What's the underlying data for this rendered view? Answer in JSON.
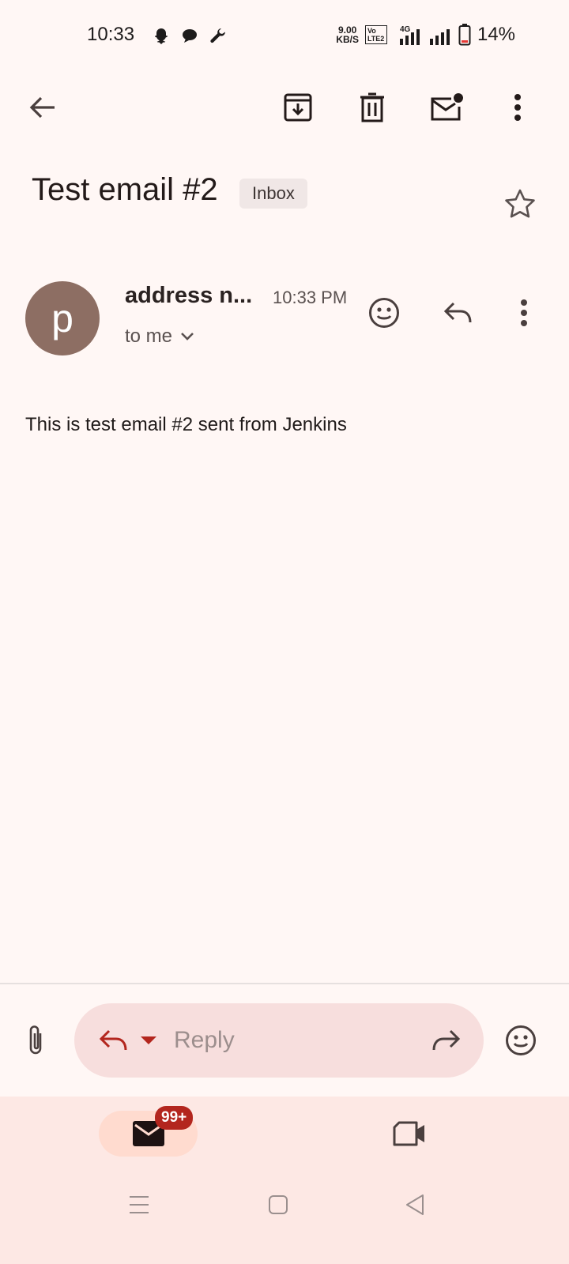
{
  "status": {
    "time": "10:33",
    "net_speed_top": "9.00",
    "net_speed_bottom": "KB/S",
    "volte": "Vo LTE2",
    "gen": "4G",
    "battery": "14%"
  },
  "toolbar": {
    "back": "back-arrow-icon",
    "archive": "archive-icon",
    "delete": "trash-icon",
    "mark_unread": "mark-unread-icon",
    "more": "more-vert-icon"
  },
  "email": {
    "subject": "Test email #2",
    "label_chip": "Inbox",
    "avatar_letter": "p",
    "sender": "address n...",
    "time": "10:33 PM",
    "to_line": "to me",
    "body": "This is test email #2 sent from Jenkins"
  },
  "reply_bar": {
    "placeholder": "Reply"
  },
  "bottom_nav": {
    "mail_badge": "99+"
  },
  "colors": {
    "background": "#fff7f5",
    "avatar": "#8d6e63",
    "reply_pill": "#f7dedd",
    "accent_red": "#b3261e",
    "nav_bg": "#fde8e4"
  }
}
